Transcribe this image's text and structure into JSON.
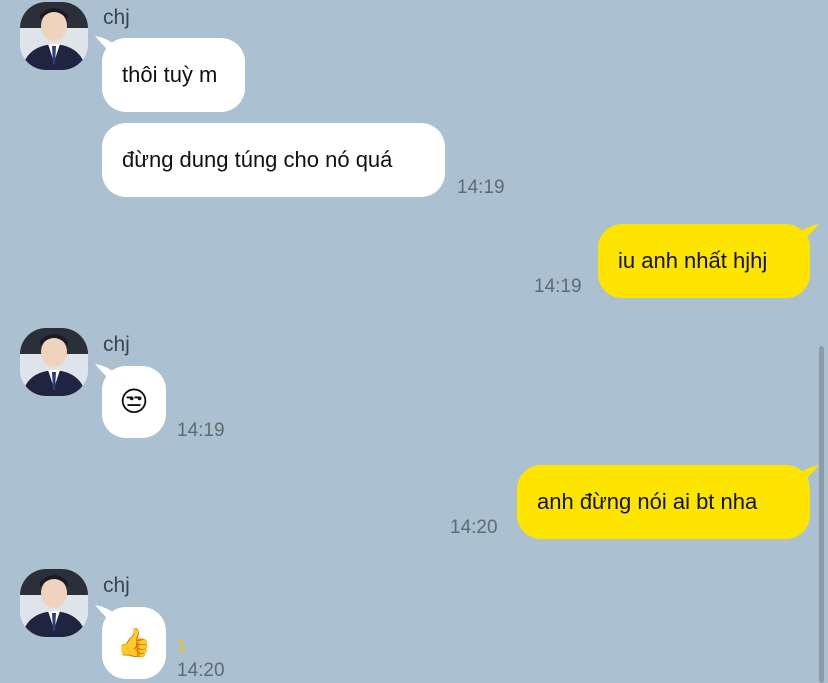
{
  "colors": {
    "background": "#abc1d1",
    "incoming": "#ffffff",
    "outgoing": "#fee500",
    "time": "#5f6b73",
    "unread": "#f2c200"
  },
  "messages": [
    {
      "sender": "chj",
      "text": "thôi tuỳ m"
    },
    {
      "text": "đừng dung túng cho nó quá",
      "time": "14:19"
    },
    {
      "text": "iu anh nhất hjhj",
      "time": "14:19"
    },
    {
      "sender": "chj",
      "emoji": "😒",
      "emoji_name": "unamused-face-icon",
      "time": "14:19"
    },
    {
      "text": "anh đừng nói ai bt nha",
      "time": "14:20"
    },
    {
      "sender": "chj",
      "emoji": "👍",
      "emoji_name": "thumbs-up-icon",
      "unread": "1",
      "time": "14:20"
    }
  ]
}
